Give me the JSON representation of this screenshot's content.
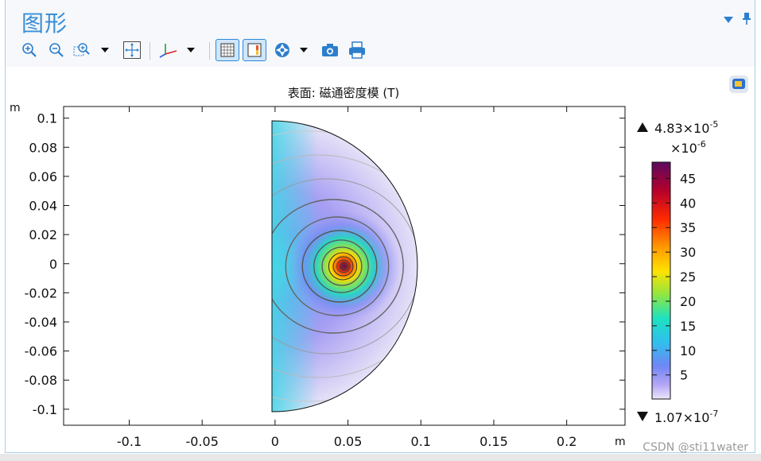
{
  "panel": {
    "title": "图形",
    "menu_icon": "triangle-down-icon",
    "pin_icon": "pin-icon"
  },
  "toolbar": {
    "items": [
      {
        "name": "zoom-in-icon"
      },
      {
        "name": "zoom-out-icon"
      },
      {
        "name": "zoom-box-icon",
        "has_dropdown": true
      },
      {
        "name": "zoom-extents-icon"
      },
      {
        "name": "axes-orientation-icon",
        "has_dropdown": true
      },
      {
        "name": "grid-toggle-icon",
        "toggled": true
      },
      {
        "name": "color-legend-toggle-icon",
        "toggled": true
      },
      {
        "name": "scene-light-icon",
        "has_dropdown": true
      },
      {
        "name": "camera-icon"
      },
      {
        "name": "print-icon"
      }
    ]
  },
  "plot": {
    "title": "表面: 磁通密度模 (T)",
    "y_unit": "m",
    "x_unit": "m",
    "x_ticks": [
      "-0.1",
      "-0.05",
      "0",
      "0.05",
      "0.1",
      "0.15",
      "0.2"
    ],
    "y_ticks": [
      "0.1",
      "0.08",
      "0.06",
      "0.04",
      "0.02",
      "0",
      "-0.02",
      "-0.04",
      "-0.06",
      "-0.08",
      "-0.1"
    ],
    "xlim": [
      -0.145,
      0.24
    ],
    "ylim": [
      -0.111,
      0.108
    ]
  },
  "colorbar": {
    "max_label": "4.83×10",
    "max_exp": "-5",
    "scale_label": "×10",
    "scale_exp": "-6",
    "ticks": [
      "45",
      "40",
      "35",
      "30",
      "25",
      "20",
      "15",
      "10",
      "5"
    ],
    "min_label": "1.07×10",
    "min_exp": "-7",
    "max_marker": "triangle-up-icon",
    "min_marker": "triangle-down-icon"
  },
  "watermark": "CSDN @sti11water",
  "colors": {
    "accent": "#3a8fd6",
    "toggle_bg": "#cfe6fb"
  }
}
